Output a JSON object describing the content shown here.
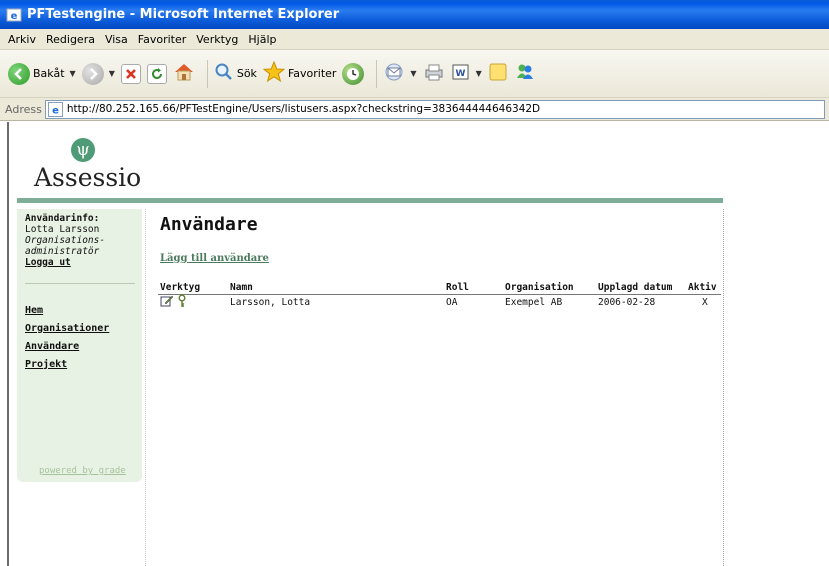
{
  "window": {
    "title": "PFTestengine - Microsoft Internet Explorer"
  },
  "menu": [
    "Arkiv",
    "Redigera",
    "Visa",
    "Favoriter",
    "Verktyg",
    "Hjälp"
  ],
  "toolbar": {
    "back_label": "Bakåt",
    "search_label": "Sök",
    "favorites_label": "Favoriter"
  },
  "address": {
    "label": "Adress",
    "url": "http://80.252.165.66/PFTestEngine/Users/listusers.aspx?checkstring=383644444646342D"
  },
  "logo": {
    "text": "Assessio"
  },
  "sidebar": {
    "info_header": "Användarinfo:",
    "user_name": "Lotta Larsson",
    "role_line1": "Organisations-",
    "role_line2": "administratör",
    "logout": "Logga ut",
    "nav": [
      "Hem",
      "Organisationer",
      "Användare",
      "Projekt"
    ],
    "powered": "powered by grade"
  },
  "main": {
    "title": "Användare",
    "add_user": "Lägg till användare",
    "columns": [
      "Verktyg",
      "Namn",
      "Roll",
      "Organisation",
      "Upplagd datum",
      "Aktiv"
    ],
    "rows": [
      {
        "name": "Larsson, Lotta",
        "role": "OA",
        "organisation": "Exempel AB",
        "created": "2006-02-28",
        "active": "X"
      }
    ]
  },
  "colors": {
    "accent_green": "#7fae98",
    "sidebar_bg": "#e8f2e4",
    "link_green": "#4b7a5d",
    "title_blue": "#0058e6"
  }
}
